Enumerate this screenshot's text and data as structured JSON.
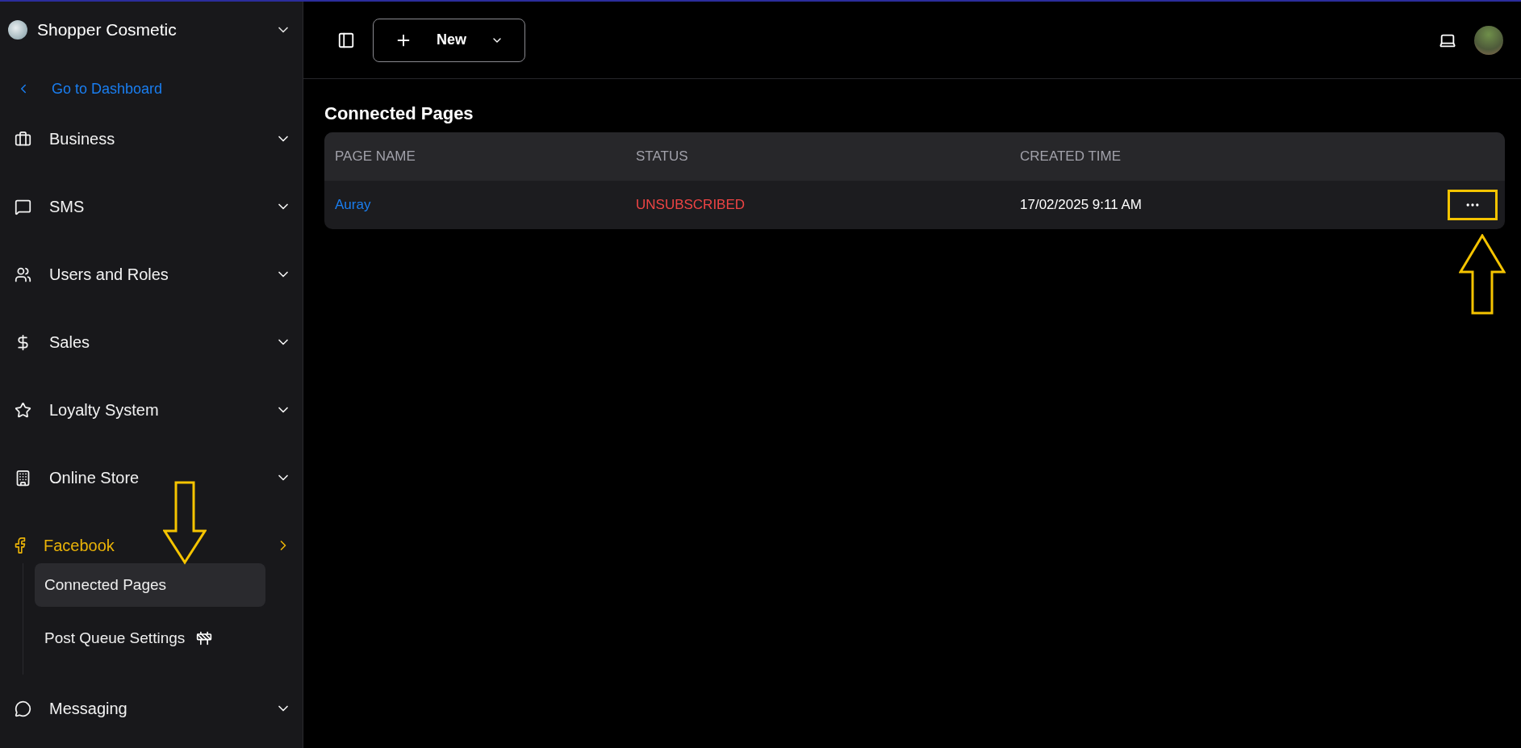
{
  "sidebar": {
    "workspace": "Shopper Cosmetic",
    "back_link": "Go to Dashboard",
    "items": [
      {
        "label": "Business",
        "selected": false
      },
      {
        "label": "SMS",
        "selected": false
      },
      {
        "label": "Users and Roles",
        "selected": false
      },
      {
        "label": "Sales",
        "selected": false
      },
      {
        "label": "Loyalty System",
        "selected": false
      },
      {
        "label": "Online Store",
        "selected": false
      },
      {
        "label": "Facebook",
        "selected": true,
        "expanded": true,
        "children": [
          {
            "label": "Connected Pages",
            "selected": true,
            "kind": "page"
          },
          {
            "label": "Post Queue Settings",
            "selected": false,
            "kind": "wip"
          }
        ]
      },
      {
        "label": "Messaging",
        "selected": false
      }
    ]
  },
  "toolbar": {
    "new_button": "New"
  },
  "page": {
    "title": "Connected Pages",
    "table": {
      "columns": [
        "PAGE NAME",
        "STATUS",
        "CREATED TIME"
      ],
      "rows": [
        {
          "page_name": "Auray",
          "status": "UNSUBSCRIBED",
          "subscribed": false,
          "created_time": "17/02/2025 9:11 AM"
        }
      ]
    }
  }
}
